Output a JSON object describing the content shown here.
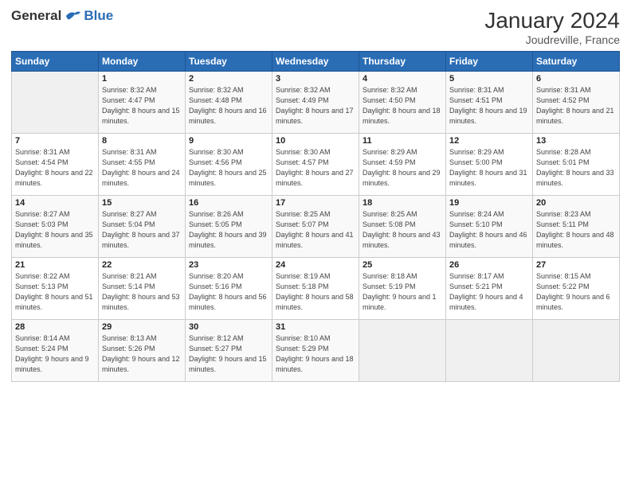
{
  "header": {
    "logo_general": "General",
    "logo_blue": "Blue",
    "title": "January 2024",
    "subtitle": "Joudreville, France"
  },
  "days_of_week": [
    "Sunday",
    "Monday",
    "Tuesday",
    "Wednesday",
    "Thursday",
    "Friday",
    "Saturday"
  ],
  "weeks": [
    [
      {
        "day": "",
        "sunrise": "",
        "sunset": "",
        "daylight": "",
        "empty": true
      },
      {
        "day": "1",
        "sunrise": "Sunrise: 8:32 AM",
        "sunset": "Sunset: 4:47 PM",
        "daylight": "Daylight: 8 hours and 15 minutes."
      },
      {
        "day": "2",
        "sunrise": "Sunrise: 8:32 AM",
        "sunset": "Sunset: 4:48 PM",
        "daylight": "Daylight: 8 hours and 16 minutes."
      },
      {
        "day": "3",
        "sunrise": "Sunrise: 8:32 AM",
        "sunset": "Sunset: 4:49 PM",
        "daylight": "Daylight: 8 hours and 17 minutes."
      },
      {
        "day": "4",
        "sunrise": "Sunrise: 8:32 AM",
        "sunset": "Sunset: 4:50 PM",
        "daylight": "Daylight: 8 hours and 18 minutes."
      },
      {
        "day": "5",
        "sunrise": "Sunrise: 8:31 AM",
        "sunset": "Sunset: 4:51 PM",
        "daylight": "Daylight: 8 hours and 19 minutes."
      },
      {
        "day": "6",
        "sunrise": "Sunrise: 8:31 AM",
        "sunset": "Sunset: 4:52 PM",
        "daylight": "Daylight: 8 hours and 21 minutes."
      }
    ],
    [
      {
        "day": "7",
        "sunrise": "Sunrise: 8:31 AM",
        "sunset": "Sunset: 4:54 PM",
        "daylight": "Daylight: 8 hours and 22 minutes."
      },
      {
        "day": "8",
        "sunrise": "Sunrise: 8:31 AM",
        "sunset": "Sunset: 4:55 PM",
        "daylight": "Daylight: 8 hours and 24 minutes."
      },
      {
        "day": "9",
        "sunrise": "Sunrise: 8:30 AM",
        "sunset": "Sunset: 4:56 PM",
        "daylight": "Daylight: 8 hours and 25 minutes."
      },
      {
        "day": "10",
        "sunrise": "Sunrise: 8:30 AM",
        "sunset": "Sunset: 4:57 PM",
        "daylight": "Daylight: 8 hours and 27 minutes."
      },
      {
        "day": "11",
        "sunrise": "Sunrise: 8:29 AM",
        "sunset": "Sunset: 4:59 PM",
        "daylight": "Daylight: 8 hours and 29 minutes."
      },
      {
        "day": "12",
        "sunrise": "Sunrise: 8:29 AM",
        "sunset": "Sunset: 5:00 PM",
        "daylight": "Daylight: 8 hours and 31 minutes."
      },
      {
        "day": "13",
        "sunrise": "Sunrise: 8:28 AM",
        "sunset": "Sunset: 5:01 PM",
        "daylight": "Daylight: 8 hours and 33 minutes."
      }
    ],
    [
      {
        "day": "14",
        "sunrise": "Sunrise: 8:27 AM",
        "sunset": "Sunset: 5:03 PM",
        "daylight": "Daylight: 8 hours and 35 minutes."
      },
      {
        "day": "15",
        "sunrise": "Sunrise: 8:27 AM",
        "sunset": "Sunset: 5:04 PM",
        "daylight": "Daylight: 8 hours and 37 minutes."
      },
      {
        "day": "16",
        "sunrise": "Sunrise: 8:26 AM",
        "sunset": "Sunset: 5:05 PM",
        "daylight": "Daylight: 8 hours and 39 minutes."
      },
      {
        "day": "17",
        "sunrise": "Sunrise: 8:25 AM",
        "sunset": "Sunset: 5:07 PM",
        "daylight": "Daylight: 8 hours and 41 minutes."
      },
      {
        "day": "18",
        "sunrise": "Sunrise: 8:25 AM",
        "sunset": "Sunset: 5:08 PM",
        "daylight": "Daylight: 8 hours and 43 minutes."
      },
      {
        "day": "19",
        "sunrise": "Sunrise: 8:24 AM",
        "sunset": "Sunset: 5:10 PM",
        "daylight": "Daylight: 8 hours and 46 minutes."
      },
      {
        "day": "20",
        "sunrise": "Sunrise: 8:23 AM",
        "sunset": "Sunset: 5:11 PM",
        "daylight": "Daylight: 8 hours and 48 minutes."
      }
    ],
    [
      {
        "day": "21",
        "sunrise": "Sunrise: 8:22 AM",
        "sunset": "Sunset: 5:13 PM",
        "daylight": "Daylight: 8 hours and 51 minutes."
      },
      {
        "day": "22",
        "sunrise": "Sunrise: 8:21 AM",
        "sunset": "Sunset: 5:14 PM",
        "daylight": "Daylight: 8 hours and 53 minutes."
      },
      {
        "day": "23",
        "sunrise": "Sunrise: 8:20 AM",
        "sunset": "Sunset: 5:16 PM",
        "daylight": "Daylight: 8 hours and 56 minutes."
      },
      {
        "day": "24",
        "sunrise": "Sunrise: 8:19 AM",
        "sunset": "Sunset: 5:18 PM",
        "daylight": "Daylight: 8 hours and 58 minutes."
      },
      {
        "day": "25",
        "sunrise": "Sunrise: 8:18 AM",
        "sunset": "Sunset: 5:19 PM",
        "daylight": "Daylight: 9 hours and 1 minute."
      },
      {
        "day": "26",
        "sunrise": "Sunrise: 8:17 AM",
        "sunset": "Sunset: 5:21 PM",
        "daylight": "Daylight: 9 hours and 4 minutes."
      },
      {
        "day": "27",
        "sunrise": "Sunrise: 8:15 AM",
        "sunset": "Sunset: 5:22 PM",
        "daylight": "Daylight: 9 hours and 6 minutes."
      }
    ],
    [
      {
        "day": "28",
        "sunrise": "Sunrise: 8:14 AM",
        "sunset": "Sunset: 5:24 PM",
        "daylight": "Daylight: 9 hours and 9 minutes."
      },
      {
        "day": "29",
        "sunrise": "Sunrise: 8:13 AM",
        "sunset": "Sunset: 5:26 PM",
        "daylight": "Daylight: 9 hours and 12 minutes."
      },
      {
        "day": "30",
        "sunrise": "Sunrise: 8:12 AM",
        "sunset": "Sunset: 5:27 PM",
        "daylight": "Daylight: 9 hours and 15 minutes."
      },
      {
        "day": "31",
        "sunrise": "Sunrise: 8:10 AM",
        "sunset": "Sunset: 5:29 PM",
        "daylight": "Daylight: 9 hours and 18 minutes."
      },
      {
        "day": "",
        "sunrise": "",
        "sunset": "",
        "daylight": "",
        "empty": true
      },
      {
        "day": "",
        "sunrise": "",
        "sunset": "",
        "daylight": "",
        "empty": true
      },
      {
        "day": "",
        "sunrise": "",
        "sunset": "",
        "daylight": "",
        "empty": true
      }
    ]
  ]
}
